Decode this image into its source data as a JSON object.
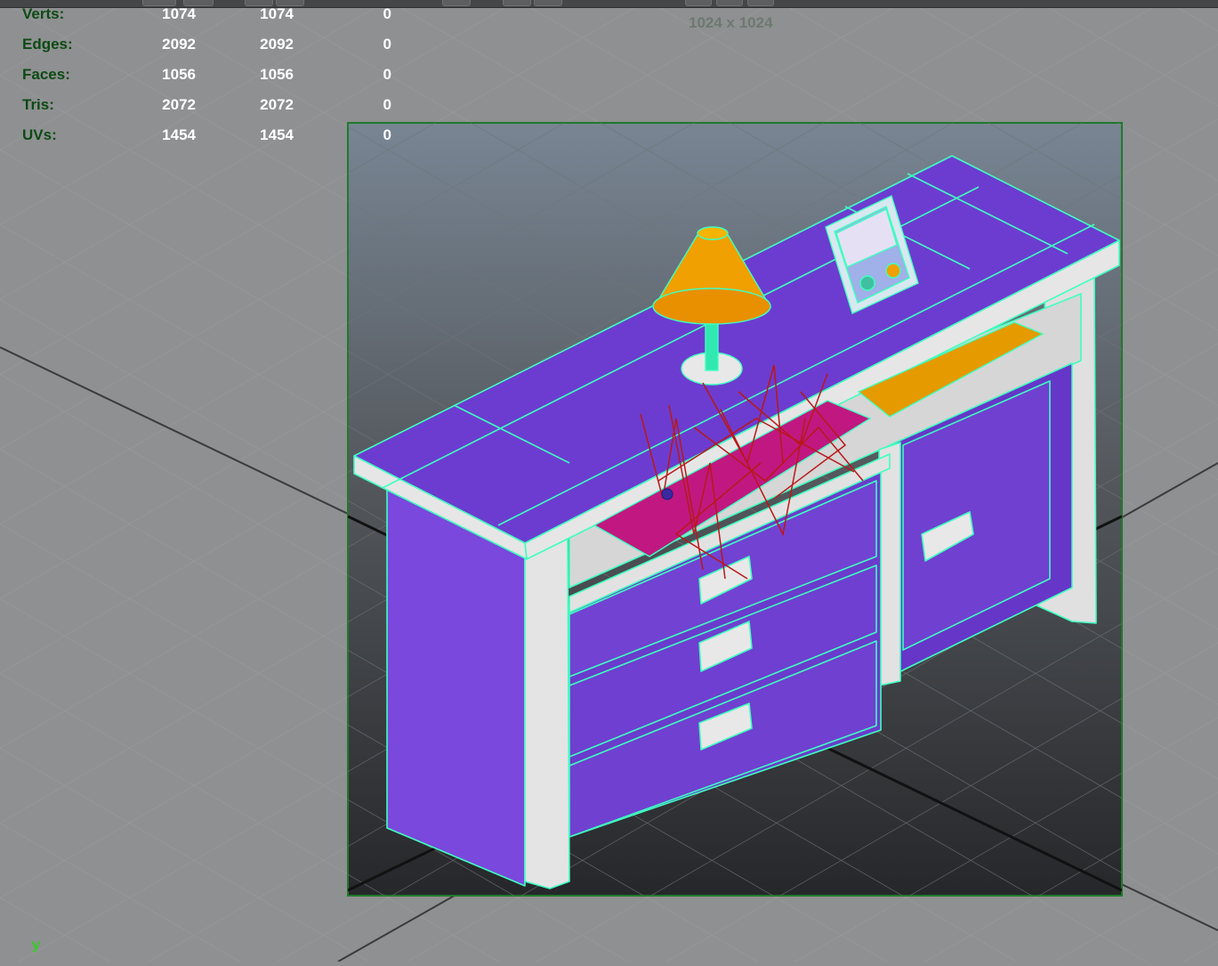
{
  "hud": {
    "rows": [
      {
        "label": "Verts:",
        "v1": "1074",
        "v2": "1074",
        "v3": "0"
      },
      {
        "label": "Edges:",
        "v1": "2092",
        "v2": "2092",
        "v3": "0"
      },
      {
        "label": "Faces:",
        "v1": "1056",
        "v2": "1056",
        "v3": "0"
      },
      {
        "label": "Tris:",
        "v1": "2072",
        "v2": "2072",
        "v3": "0"
      },
      {
        "label": "UVs:",
        "v1": "1454",
        "v2": "1454",
        "v3": "0"
      }
    ]
  },
  "resolution_gate": {
    "label": "1024 x 1024"
  },
  "axis": {
    "label": "y"
  },
  "colors": {
    "viewport_bg": "#8f9092",
    "hud_label": "#0d4a14",
    "hud_value": "#ffffff",
    "wireframe": "#3fffc0",
    "furniture": "#7040d0",
    "trim": "#e2e2e2",
    "lamp": "#f0a000",
    "book": "#c01880",
    "gate_border": "#1f7a2a"
  },
  "scene": {
    "object": "sideboard-cabinet",
    "display_mode": "wireframe-on-shaded"
  }
}
